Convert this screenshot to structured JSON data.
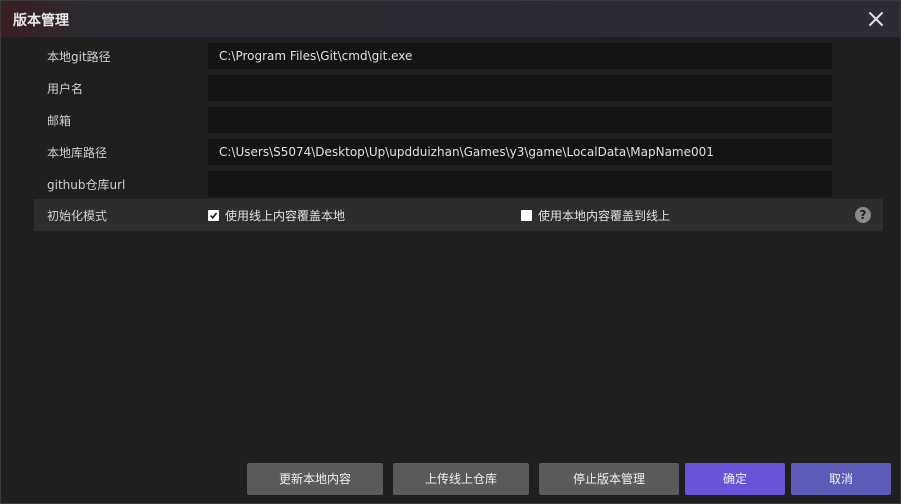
{
  "window": {
    "title": "版本管理"
  },
  "form": {
    "git_path": {
      "label": "本地git路径",
      "value": "C:\\Program Files\\Git\\cmd\\git.exe"
    },
    "username": {
      "label": "用户名",
      "value": ""
    },
    "email": {
      "label": "邮箱",
      "value": ""
    },
    "repo_path": {
      "label": "本地库路径",
      "value": "C:\\Users\\S5074\\Desktop\\Up\\updduizhan\\Games\\y3\\game\\LocalData\\MapName001"
    },
    "github_url": {
      "label": "github仓库url",
      "value": ""
    },
    "init_mode": {
      "label": "初始化模式",
      "option_online": {
        "label": "使用线上内容覆盖本地",
        "checked": true
      },
      "option_local": {
        "label": "使用本地内容覆盖到线上",
        "checked": false
      },
      "help_icon": "question-circle-icon",
      "help_glyph": "?"
    }
  },
  "buttons": {
    "update_local": "更新本地内容",
    "upload_repo": "上传线上仓库",
    "stop_version": "停止版本管理",
    "confirm": "确定",
    "cancel": "取消"
  },
  "colors": {
    "primary": "#6b53d8",
    "secondary": "#5e5ab8",
    "gray_button": "#5a5a5c",
    "background": "#1f1f20",
    "input_bg": "#141414"
  }
}
